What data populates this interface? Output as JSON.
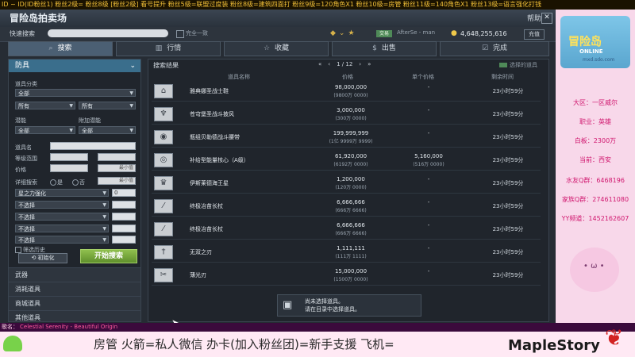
{
  "ticker": "ID ~ ID(ID粉丝1)  粉丝2级=  粉丝8级  [粉丝2级] 看号提升 粉丝5级=联盟过度装 粉丝8级=建筑四面打 粉丝9级=120角色X1 粉丝10级=房管 粉丝11级=140角色X1 粉丝13级=语言强化打钱",
  "window": {
    "title": "冒险岛拍卖场",
    "help": "帮助",
    "close": "✕"
  },
  "subbar": {
    "search_label": "快速搜索",
    "exact_label": "完全一致",
    "badge": "交易",
    "user": "AfterSe - man",
    "money": "4,648,255,616",
    "charge": "充值"
  },
  "tabs": [
    {
      "label": "搜索",
      "icon": "search-icon",
      "glyph": "⌕"
    },
    {
      "label": "行情",
      "icon": "chart-icon",
      "glyph": "▥"
    },
    {
      "label": "收藏",
      "icon": "star-icon",
      "glyph": "☆"
    },
    {
      "label": "出售",
      "icon": "sell-icon",
      "glyph": "$"
    },
    {
      "label": "完成",
      "icon": "check-icon",
      "glyph": "☑"
    }
  ],
  "filter": {
    "category": "防具",
    "item_class_label": "道具分类",
    "sel_all": "全部",
    "sel_any_left": "所有",
    "sel_any_right": "所有",
    "potential_label": "潜能",
    "extra_potential_label": "附加潜能",
    "pot_sel": "全部",
    "pot_sel2": "全部",
    "item_name_label": "道具名",
    "level_label": "等级范围",
    "price_label": "价格",
    "price_max": "最小值",
    "detail_label": "详细搜索",
    "detail_opt1": "是",
    "detail_opt2": "否",
    "detail_min": "最小值",
    "enhance_sel": "星之力强化",
    "enhance_val": "0",
    "opt_sel1": "不选择",
    "opt_sel2": "不选择",
    "opt_sel3": "不选择",
    "opt_sel4": "不选择",
    "history_label": "筛选历史",
    "init_button": "初始化",
    "search_button": "开始搜索",
    "categories": [
      "武器",
      "消耗道具",
      "商城道具",
      "其他道具"
    ]
  },
  "results": {
    "label": "搜索结果",
    "page": "1 / 12",
    "selected_label": "选择的道具",
    "columns": {
      "name": "道具名称",
      "price": "价格",
      "unit": "单个价格",
      "time": "剩余时间"
    },
    "rows": [
      {
        "icon": "boots-icon",
        "glyph": "⌂",
        "name": "雅典娜圣战士鞋",
        "price": "98,000,000",
        "price_sub": "(9800万 0000)",
        "unit": "-",
        "unit_sub": "",
        "time": "23小时59分"
      },
      {
        "icon": "cape-icon",
        "glyph": "♆",
        "name": "苍穹堡圣战斗披风",
        "price": "3,000,000",
        "price_sub": "(300万 0000)",
        "unit": "-",
        "unit_sub": "",
        "time": "23小时59分"
      },
      {
        "icon": "belt-icon",
        "glyph": "◉",
        "name": "瓶组贝勒德战斗腰带",
        "price": "199,999,999",
        "price_sub": "(1亿 9999万 9999)",
        "unit": "-",
        "unit_sub": "",
        "time": "23小时59分"
      },
      {
        "icon": "core-icon",
        "glyph": "◎",
        "name": "补给型能量核心（A级）",
        "price": "61,920,000",
        "price_sub": "(6192万 0000)",
        "unit": "5,160,000",
        "unit_sub": "(516万 0000)",
        "time": "23小时59分"
      },
      {
        "icon": "crown-icon",
        "glyph": "♛",
        "name": "伊斯莱德海王星",
        "price": "1,200,000",
        "price_sub": "(120万 0000)",
        "unit": "-",
        "unit_sub": "",
        "time": "23小时59分"
      },
      {
        "icon": "staff-icon",
        "glyph": "⁄",
        "name": "终极冶苗长杖",
        "price": "6,666,666",
        "price_sub": "(666万 6666)",
        "unit": "-",
        "unit_sub": "",
        "time": "23小时59分"
      },
      {
        "icon": "staff-icon",
        "glyph": "⁄",
        "name": "终极冶苗长杖",
        "price": "6,666,666",
        "price_sub": "(666万 6666)",
        "unit": "-",
        "unit_sub": "",
        "time": "23小时59分"
      },
      {
        "icon": "sword-icon",
        "glyph": "†",
        "name": "无双之刃",
        "price": "1,111,111",
        "price_sub": "(111万 1111)",
        "unit": "-",
        "unit_sub": "",
        "time": "23小时59分"
      },
      {
        "icon": "blade-icon",
        "glyph": "✂",
        "name": "薄光刃",
        "price": "15,000,000",
        "price_sub": "(1500万 0000)",
        "unit": "-",
        "unit_sub": "",
        "time": "23小时59分"
      }
    ],
    "detail_line1": "尚未选择道具。",
    "detail_line2": "请在目录中选择道具。"
  },
  "side": {
    "logo_title": "冒险岛",
    "logo_sub": "ONLINE",
    "logo_url": "mxd.sdo.com",
    "info": [
      "大区：一区威尔",
      "职业：英雄",
      "白板：2300万",
      "当前：西安",
      "水友Q群：6468196",
      "家族Q群：274611080",
      "YY频道：1452162607"
    ]
  },
  "bottom": {
    "song_label": "歌名：",
    "song": "Celestial Serenity - Beautiful Origin",
    "marquee": "房管   火箭=私人微信   办卡(加入粉丝团)=新手支援   飞机=",
    "brand": "MapleStory"
  },
  "colors": {
    "accent": "#3a6e8c",
    "search_button": "#7aab3c",
    "pink": "#d0166e",
    "gold": "#f0c94a"
  }
}
